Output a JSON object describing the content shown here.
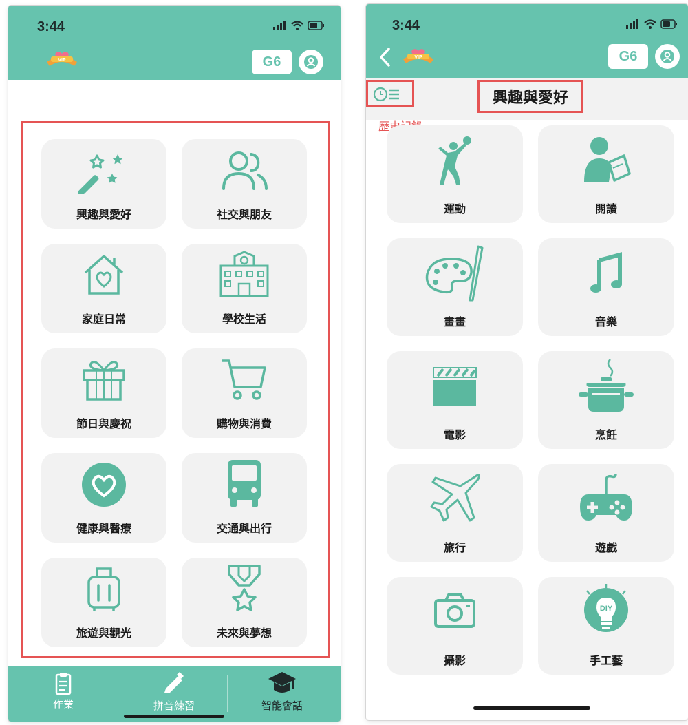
{
  "left": {
    "status_time": "3:44",
    "grade_badge": "G6",
    "categories": [
      {
        "label": "興趣與愛好",
        "icon": "magic-wand-icon"
      },
      {
        "label": "社交與朋友",
        "icon": "people-icon"
      },
      {
        "label": "家庭日常",
        "icon": "home-heart-icon"
      },
      {
        "label": "學校生活",
        "icon": "school-building-icon"
      },
      {
        "label": "節日與慶祝",
        "icon": "gift-icon"
      },
      {
        "label": "購物與消費",
        "icon": "shopping-cart-icon"
      },
      {
        "label": "健康與醫療",
        "icon": "heart-circle-icon"
      },
      {
        "label": "交通與出行",
        "icon": "bus-icon"
      },
      {
        "label": "旅遊與觀光",
        "icon": "suitcase-icon"
      },
      {
        "label": "未來與夢想",
        "icon": "medal-icon"
      }
    ],
    "tabs": [
      {
        "label": "作業",
        "icon": "clipboard-icon"
      },
      {
        "label": "拼音練習",
        "icon": "pencil-icon"
      },
      {
        "label": "智能會話",
        "icon": "graduation-cap-icon"
      }
    ]
  },
  "right": {
    "status_time": "3:44",
    "grade_badge": "G6",
    "page_title": "興趣與愛好",
    "history_label": "歷史記錄",
    "topics": [
      {
        "label": "運動",
        "icon": "volleyball-player-icon"
      },
      {
        "label": "閱讀",
        "icon": "reader-icon"
      },
      {
        "label": "畫畫",
        "icon": "palette-icon"
      },
      {
        "label": "音樂",
        "icon": "music-note-icon"
      },
      {
        "label": "電影",
        "icon": "clapperboard-icon"
      },
      {
        "label": "烹飪",
        "icon": "cooking-pot-icon"
      },
      {
        "label": "旅行",
        "icon": "airplane-icon"
      },
      {
        "label": "遊戲",
        "icon": "game-controller-icon"
      },
      {
        "label": "攝影",
        "icon": "camera-icon"
      },
      {
        "label": "手工藝",
        "icon": "diy-lightbulb-icon"
      }
    ]
  },
  "colors": {
    "accent": "#66c3ae",
    "icon": "#5bb89f",
    "tile_bg": "#f2f2f2",
    "highlight_border": "#e55454"
  }
}
